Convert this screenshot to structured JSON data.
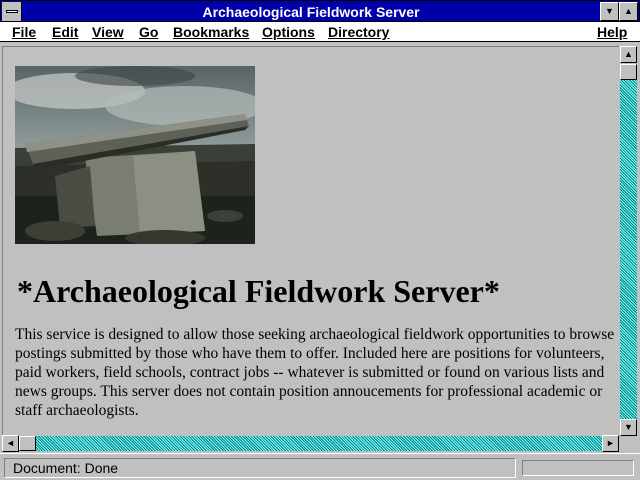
{
  "window": {
    "title": "Archaeological Fieldwork Server",
    "title_bar_color": "#0000a8"
  },
  "menu": {
    "items": [
      "File",
      "Edit",
      "View",
      "Go",
      "Bookmarks",
      "Options",
      "Directory"
    ],
    "help": "Help"
  },
  "page": {
    "image_alt": "stone dolmen photograph",
    "heading": "*Archaeological Fieldwork Server*",
    "body": "This service is designed to allow those seeking archaeological fieldwork opportunities to browse postings submitted by those who have them to offer. Included here are positions for volunteers, paid workers, field schools, contract jobs -- whatever is submitted or found on various lists and news groups. This server does not contain position annoucements for professional academic or staff archaeologists."
  },
  "status": {
    "text": "Document: Done",
    "progress": 0
  },
  "icons": {
    "minimize": "down-triangle-icon",
    "maximize": "up-triangle-icon",
    "scroll_up": "up-arrow-icon",
    "scroll_down": "down-arrow-icon",
    "scroll_left": "left-arrow-icon",
    "scroll_right": "right-arrow-icon"
  },
  "colors": {
    "scrollbar_track": "#40c0c0",
    "face": "#c0c0c0"
  }
}
